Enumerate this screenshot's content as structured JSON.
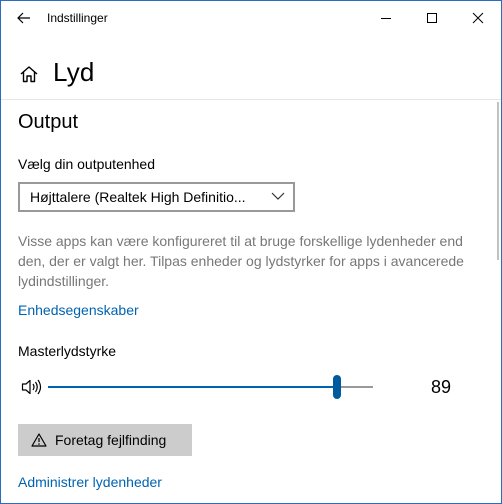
{
  "window": {
    "title": "Indstillinger"
  },
  "header": {
    "title": "Lyd"
  },
  "output": {
    "section_title": "Output",
    "device_label": "Vælg din outputenhed",
    "device_value": "Højttalere (Realtek High Definitio...",
    "description": "Visse apps kan være konfigureret til at bruge forskellige lydenheder end den, der er valgt her. Tilpas enheder og lydstyrker for apps i avancerede lydindstillinger.",
    "device_properties_link": "Enhedsegenskaber",
    "volume_label": "Masterlydstyrke",
    "volume_value": "89",
    "volume_level": 0.89,
    "troubleshoot_label": "Foretag fejlfinding",
    "manage_devices_link": "Administrer lydenheder"
  },
  "icons": {
    "back": "back-arrow-icon",
    "minimize": "minimize-icon",
    "maximize": "maximize-icon",
    "close": "close-icon",
    "home": "home-icon",
    "chevron": "chevron-down-icon",
    "speaker": "speaker-icon",
    "warning": "warning-icon"
  },
  "colors": {
    "accent": "#0063b1",
    "window_border": "#2b6cbd",
    "button_bg": "#cccccc",
    "description_text": "#777777"
  }
}
